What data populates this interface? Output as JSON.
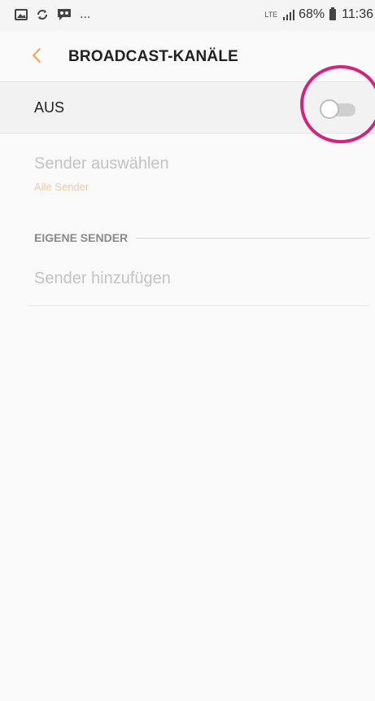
{
  "status_bar": {
    "left_icons": [
      "gallery-icon",
      "sync-icon",
      "voicemail-icon"
    ],
    "overflow_text": "...",
    "network": "LTE",
    "signal_icon": "signal-bars-icon",
    "battery_percent": "68%",
    "time": "11:36"
  },
  "header": {
    "back_icon": "chevron-left-icon",
    "title": "BROADCAST-KANÄLE",
    "accent_color": "#f2a157"
  },
  "master_switch": {
    "label": "AUS",
    "state": "off",
    "highlight_color": "#d6227e"
  },
  "settings": {
    "select_sender": {
      "title": "Sender auswählen",
      "value": "Alle Sender"
    },
    "section_title": "EIGENE SENDER",
    "add_sender": {
      "title": "Sender hinzufügen"
    }
  }
}
